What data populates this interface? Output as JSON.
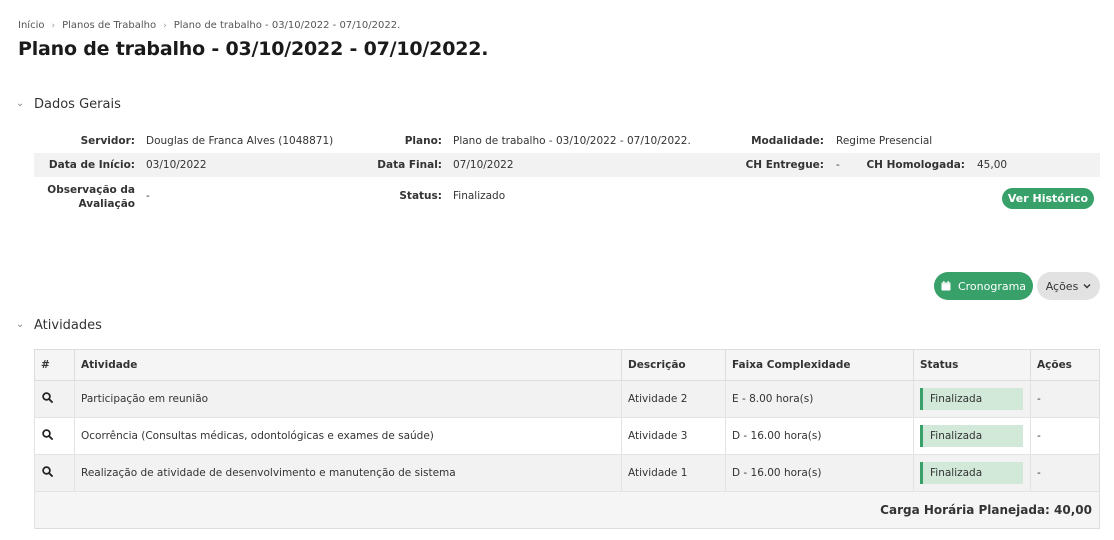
{
  "breadcrumb": {
    "home": "Início",
    "plans": "Planos de Trabalho",
    "current": "Plano de trabalho - 03/10/2022 - 07/10/2022."
  },
  "page_title": "Plano de trabalho - 03/10/2022 - 07/10/2022.",
  "general": {
    "section_title": "Dados Gerais",
    "servidor_label": "Servidor:",
    "servidor_value": "Douglas de Franca Alves (1048871)",
    "plano_label": "Plano:",
    "plano_value": "Plano de trabalho - 03/10/2022 - 07/10/2022.",
    "modalidade_label": "Modalidade:",
    "modalidade_value": "Regime Presencial",
    "data_inicio_label": "Data de Início:",
    "data_inicio_value": "03/10/2022",
    "data_final_label": "Data Final:",
    "data_final_value": "07/10/2022",
    "ch_entregue_label": "CH Entregue:",
    "ch_entregue_value": "-",
    "ch_homologada_label": "CH Homologada:",
    "ch_homologada_value": "45,00",
    "observacao_label_1": "Observação da",
    "observacao_label_2": "Avaliação",
    "observacao_value": "-",
    "status_label": "Status:",
    "status_value": "Finalizado",
    "ver_historico": "Ver Histórico"
  },
  "toolbar": {
    "cronograma": "Cronograma",
    "acoes": "Ações"
  },
  "activities": {
    "section_title": "Atividades",
    "columns": {
      "num": "#",
      "atividade": "Atividade",
      "descricao": "Descrição",
      "faixa": "Faixa Complexidade",
      "status": "Status",
      "acoes": "Ações"
    },
    "rows": [
      {
        "atividade": "Participação em reunião",
        "descricao": "Atividade 2",
        "faixa": "E - 8.00 hora(s)",
        "status": "Finalizada",
        "acoes": "-"
      },
      {
        "atividade": "Ocorrência (Consultas médicas, odontológicas e exames de saúde)",
        "descricao": "Atividade 3",
        "faixa": "D - 16.00 hora(s)",
        "status": "Finalizada",
        "acoes": "-"
      },
      {
        "atividade": "Realização de atividade de desenvolvimento e manutenção de sistema",
        "descricao": "Atividade 1",
        "faixa": "D - 16.00 hora(s)",
        "status": "Finalizada",
        "acoes": "-"
      }
    ],
    "footer": "Carga Horária Planejada: 40,00"
  },
  "colors": {
    "accent_green": "#37a169",
    "badge_bg": "#d2e9d9"
  },
  "icons": {
    "row_action": "search-icon",
    "calendar": "calendar-icon",
    "dropdown": "chevron-down-icon",
    "collapse": "chevron-down-icon"
  }
}
